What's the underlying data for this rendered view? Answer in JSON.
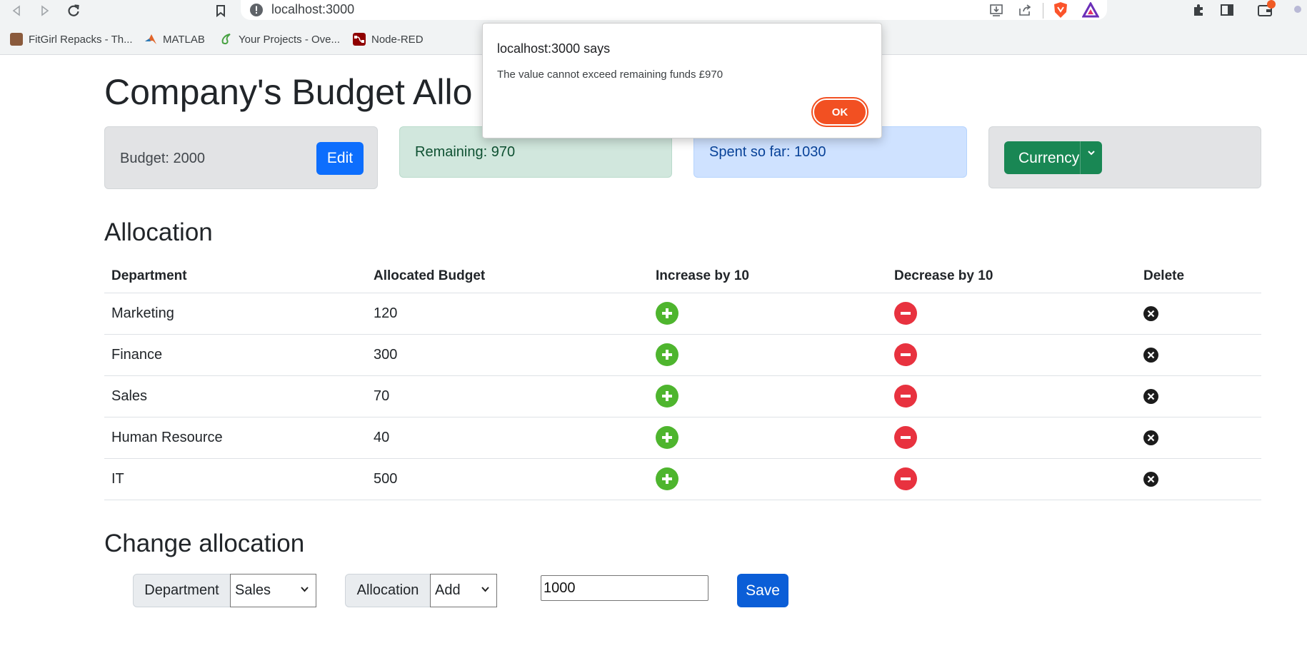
{
  "browser": {
    "url": "localhost:3000",
    "bookmarks": [
      "FitGirl Repacks - Th...",
      "MATLAB",
      "Your Projects - Ove...",
      "Node-RED"
    ]
  },
  "page": {
    "title": "Company's Budget Allo",
    "budget_label": "Budget: 2000",
    "edit_label": "Edit",
    "remaining_label": "Remaining: 970",
    "spent_label": "Spent so far: 1030",
    "currency_label": "Currency"
  },
  "allocation": {
    "heading": "Allocation",
    "headers": [
      "Department",
      "Allocated Budget",
      "Increase by 10",
      "Decrease by 10",
      "Delete"
    ],
    "rows": [
      {
        "department": "Marketing",
        "budget": "120"
      },
      {
        "department": "Finance",
        "budget": "300"
      },
      {
        "department": "Sales",
        "budget": "70"
      },
      {
        "department": "Human Resource",
        "budget": "40"
      },
      {
        "department": "IT",
        "budget": "500"
      }
    ]
  },
  "change": {
    "heading": "Change allocation",
    "department_label": "Department",
    "department_value": "Sales",
    "allocation_label": "Allocation",
    "allocation_value": "Add",
    "amount_value": "1000",
    "save_label": "Save"
  },
  "dialog": {
    "title": "localhost:3000 says",
    "message": "The value cannot exceed remaining funds  £970",
    "ok_label": "OK"
  },
  "colors": {
    "primary": "#0d6efd",
    "success": "#198754",
    "plus_icon": "#4eb52e",
    "minus_icon": "#e8323f",
    "dialog_ok": "#f25022"
  }
}
